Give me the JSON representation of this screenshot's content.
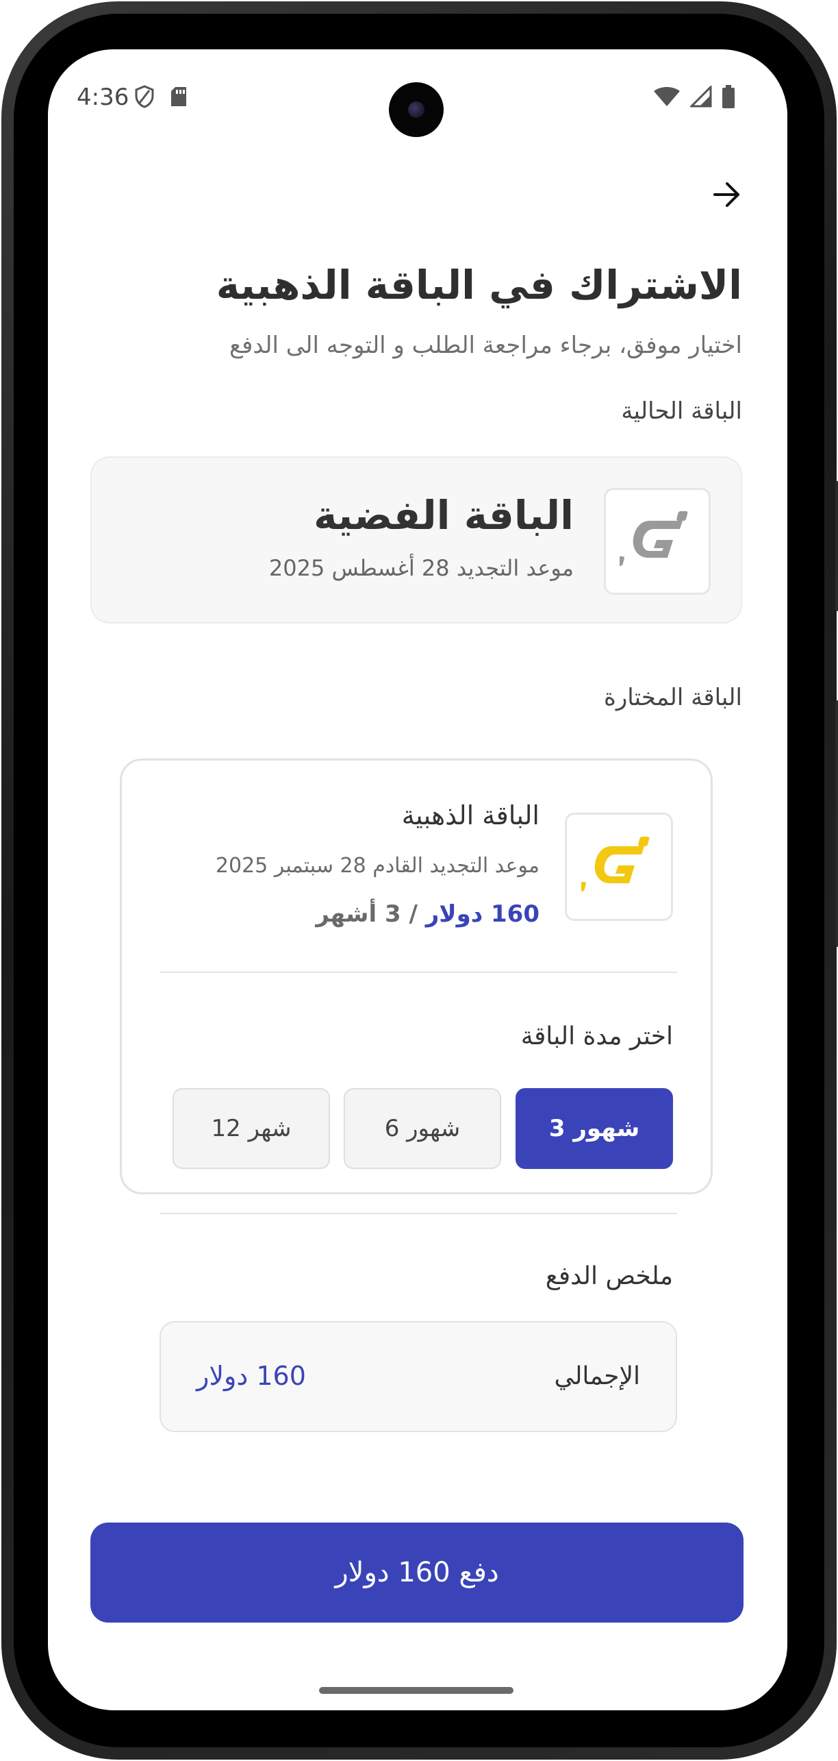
{
  "status_bar": {
    "time": "4:36"
  },
  "header": {
    "title": "الاشتراك في الباقة الذهبية",
    "subtitle": "اختيار موفق، برجاء مراجعة الطلب و التوجه الى الدفع"
  },
  "current_plan": {
    "section_label": "الباقة الحالية",
    "name": "الباقة الفضية",
    "renewal": "موعد التجديد 28 أغسطس 2025",
    "logo_color": "#9a9a9a"
  },
  "selected_plan": {
    "section_label": "الباقة المختارة",
    "name": "الباقة الذهبية",
    "renewal": "موعد التجديد القادم 28 سبتمبر 2025",
    "price_amount": "160 دولار",
    "price_period": " / 3 أشهر",
    "logo_color": "#f2c811"
  },
  "duration": {
    "label": "اختر مدة الباقة",
    "options": [
      "3 شهور",
      "6 شهور",
      "12 شهر"
    ],
    "selected_index": 0
  },
  "summary": {
    "label": "ملخص الدفع",
    "total_label": "الإجمالي",
    "total_value": "160 دولار"
  },
  "pay_button": {
    "label": "دفع 160 دولار"
  },
  "colors": {
    "primary": "#3a44b8",
    "gold": "#f2c811",
    "silver": "#9a9a9a"
  }
}
